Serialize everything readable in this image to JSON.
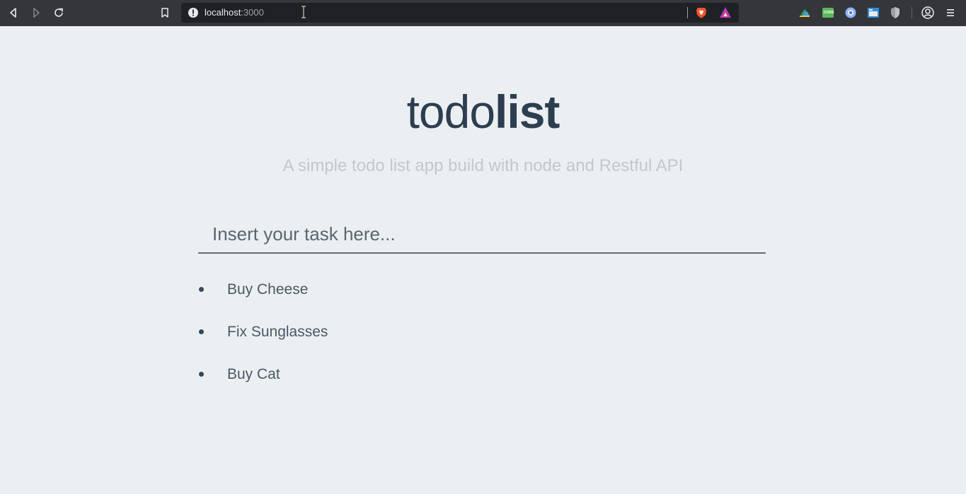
{
  "browser": {
    "url_host": "localhost",
    "url_port": ":3000",
    "colors": {
      "chrome": "#35363a",
      "addressbar": "#202124"
    },
    "icons": {
      "back": "back-arrow-icon",
      "forward": "forward-arrow-icon",
      "reload": "reload-icon",
      "bookmark": "bookmark-icon",
      "site_info": "info-icon",
      "brave": "brave-shield-icon",
      "rewards": "brave-rewards-icon",
      "extensions": [
        "tree-extension-icon",
        "cors-extension-icon",
        "blue-circle-extension-icon",
        "window-extension-icon",
        "shield-extension-icon"
      ],
      "profile": "profile-icon",
      "menu": "menu-icon"
    },
    "cors_label": "CORS"
  },
  "page": {
    "title_light": "todo",
    "title_bold": "list",
    "subtitle": "A simple todo list app build with node and Restful API",
    "input_placeholder": "Insert your task here...",
    "tasks": [
      {
        "label": "Buy Cheese"
      },
      {
        "label": "Fix Sunglasses"
      },
      {
        "label": "Buy Cat"
      }
    ],
    "colors": {
      "background": "#eceff1",
      "title": "#2c3e50",
      "subtitle": "#c3c8cc",
      "task_text": "#4a5866"
    }
  }
}
